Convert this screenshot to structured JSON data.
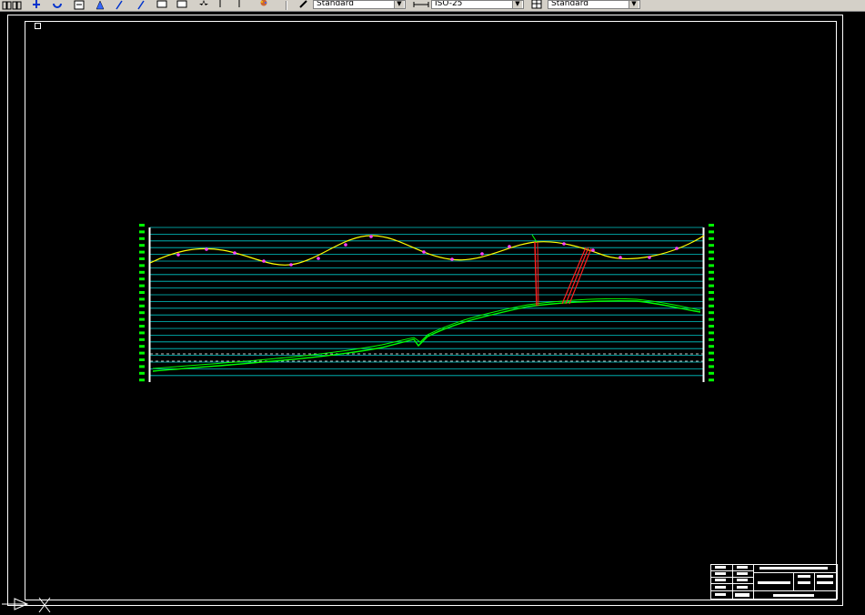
{
  "toolbar": {
    "icons": [
      "layout-icon",
      "tile-icon",
      "pan-icon",
      "refresh-icon",
      "properties-icon",
      "measure-icon",
      "line-icon",
      "polyline-icon",
      "rectangle-icon",
      "rectangle-icon",
      "star-icon",
      "insert-icon",
      "point-icon",
      "palette-icon"
    ],
    "text_style_combo": {
      "value": "Standard"
    },
    "dim_style_combo": {
      "value": "ISO-25"
    },
    "table_style_combo": {
      "value": "Standard"
    }
  },
  "drawing": {
    "background": "#000000",
    "colors": {
      "frame": "#ffffff",
      "grid": "#00c8c8",
      "profile": "#00ff00",
      "curve": "#ffff00",
      "marker": "#ff40ff",
      "structure": "#ff2020"
    },
    "icons": [
      "ucs-axis-icon",
      "crosshair-icon",
      "viewport-marker-icon"
    ]
  }
}
